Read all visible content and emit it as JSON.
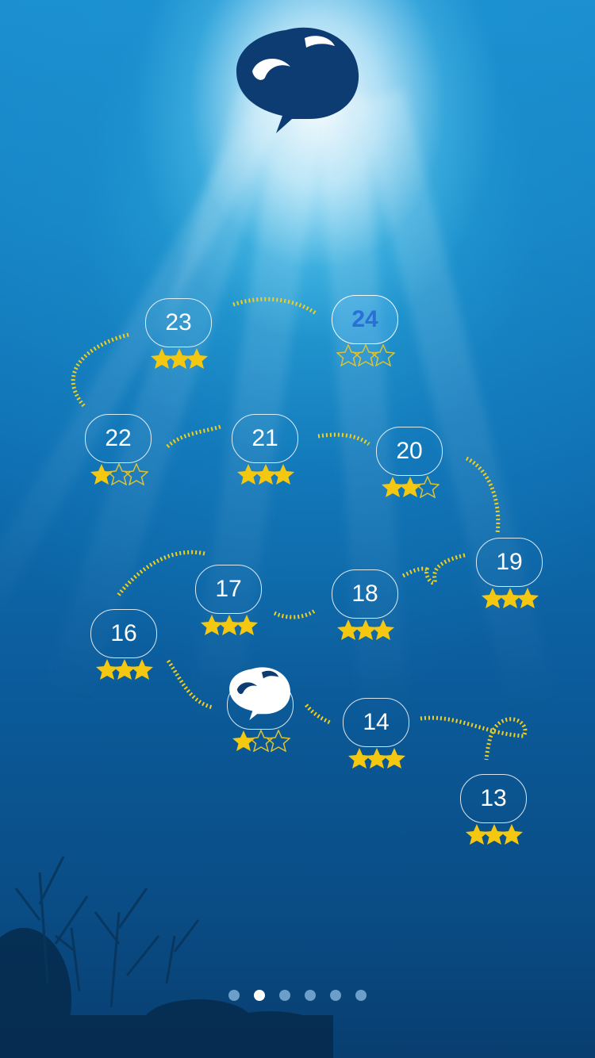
{
  "app": {
    "logo_icon": "whale-icon"
  },
  "colors": {
    "path": "#f2cf1a",
    "star": "#f4c710",
    "star_outline": "#d9c23a",
    "current_text": "#2a6fd6"
  },
  "levels": [
    {
      "number": "23",
      "stars": 3,
      "current": false
    },
    {
      "number": "24",
      "stars": 0,
      "current": true
    },
    {
      "number": "22",
      "stars": 1,
      "current": false
    },
    {
      "number": "21",
      "stars": 3,
      "current": false
    },
    {
      "number": "20",
      "stars": 2,
      "current": false
    },
    {
      "number": "19",
      "stars": 3,
      "current": false
    },
    {
      "number": "17",
      "stars": 3,
      "current": false
    },
    {
      "number": "18",
      "stars": 3,
      "current": false
    },
    {
      "number": "16",
      "stars": 3,
      "current": false
    },
    {
      "number": "",
      "stars": 1,
      "current": false,
      "icon": "whale-icon"
    },
    {
      "number": "14",
      "stars": 3,
      "current": false
    },
    {
      "number": "13",
      "stars": 3,
      "current": false
    }
  ],
  "pager": {
    "pages": 6,
    "active_index": 1
  }
}
